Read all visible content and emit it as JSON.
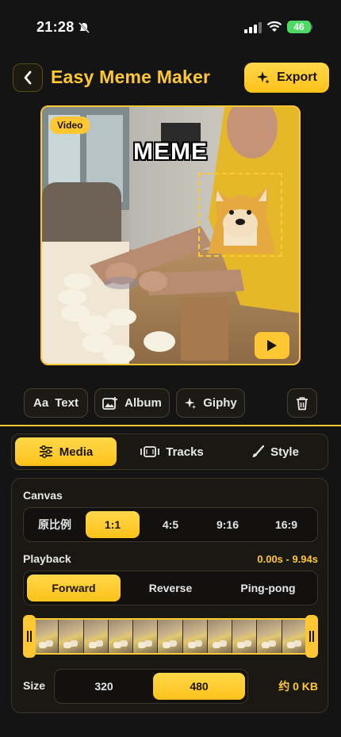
{
  "status": {
    "time": "21:28",
    "battery": "46"
  },
  "header": {
    "title": "Easy Meme Maker",
    "export_label": "Export"
  },
  "preview": {
    "badge": "Video",
    "meme_text": "MEME"
  },
  "tools": {
    "text": "Text",
    "text_icon": "Aa",
    "album": "Album",
    "giphy": "Giphy"
  },
  "tabs": [
    {
      "label": "Media",
      "icon": "sliders-icon",
      "active": true
    },
    {
      "label": "Tracks",
      "icon": "film-icon",
      "active": false
    },
    {
      "label": "Style",
      "icon": "brush-icon",
      "active": false
    }
  ],
  "canvas": {
    "label": "Canvas",
    "options": [
      "原比例",
      "1:1",
      "4:5",
      "9:16",
      "16:9"
    ],
    "selected": "1:1"
  },
  "playback": {
    "label": "Playback",
    "range": "0.00s - 9.94s",
    "options": [
      "Forward",
      "Reverse",
      "Ping-pong"
    ],
    "selected": "Forward"
  },
  "size": {
    "label": "Size",
    "options": [
      "320",
      "480"
    ],
    "selected": "480",
    "estimate": "约 0 KB"
  },
  "colors": {
    "accent": "#ffc832",
    "background": "#141414"
  }
}
